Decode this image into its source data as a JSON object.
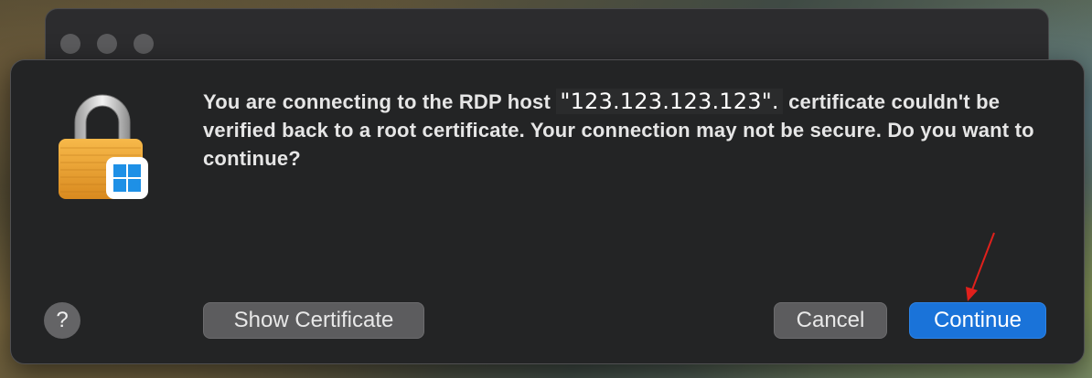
{
  "dialog": {
    "message_before": "You are connecting to the RDP host ",
    "host": "\"123.123.123.123\".",
    "message_after": " certificate couldn't be verified back to a root certificate. Your connection may not be secure. Do you want to continue?"
  },
  "buttons": {
    "help_label": "?",
    "show_certificate_label": "Show Certificate",
    "cancel_label": "Cancel",
    "continue_label": "Continue"
  },
  "colors": {
    "accent": "#1a73d9",
    "annotation_arrow": "#e0201c"
  }
}
